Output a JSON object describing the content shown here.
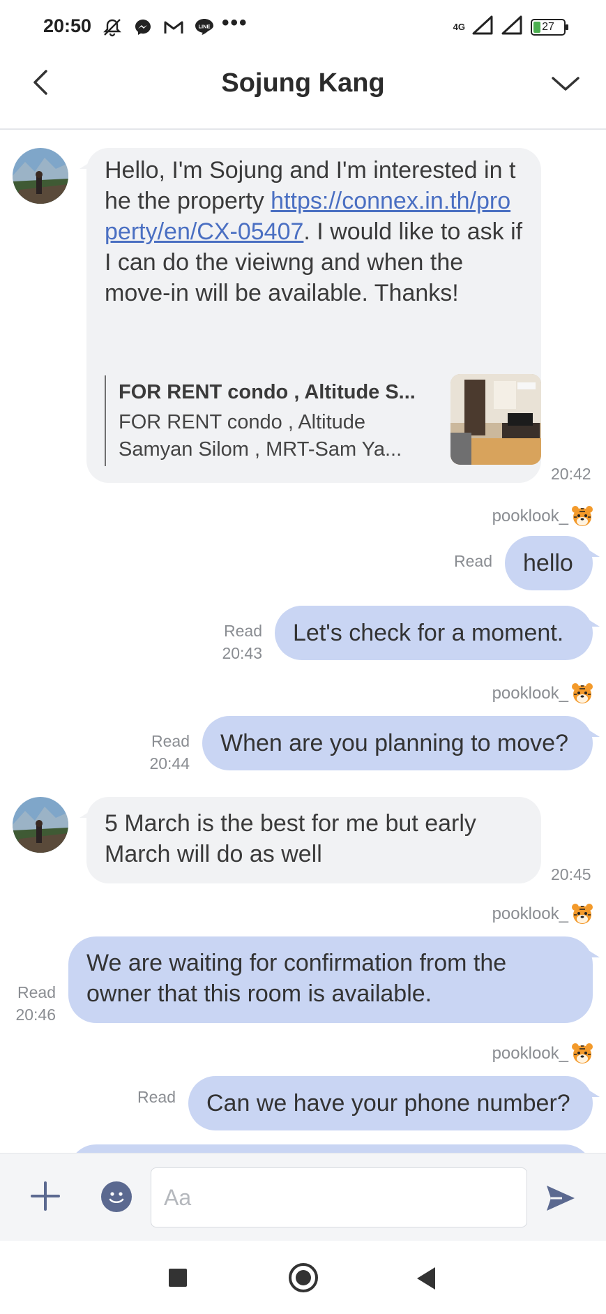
{
  "status_bar": {
    "time": "20:50",
    "icons": [
      "notifications-off-icon",
      "messenger-icon",
      "gmail-icon",
      "line-icon"
    ],
    "more": "•••",
    "network": "4G",
    "battery": "27"
  },
  "header": {
    "title": "Sojung Kang"
  },
  "messages": [
    {
      "direction": "in",
      "text_before_link": "Hello, I'm Sojung and I'm interested in the the property ",
      "link": "https://connex.in.th/property/en/CX-05407",
      "text_after_link": ". I would like to ask if I can do the vieiwng and when the move-in will be available. Thanks!",
      "preview_title": "FOR RENT condo , Altitude S...",
      "preview_desc": "FOR RENT condo , Altitude Samyan Silom , MRT-Sam Ya...",
      "time": "20:42"
    },
    {
      "direction": "out",
      "sender": "pooklook_",
      "text": "hello",
      "read": "Read",
      "time": ""
    },
    {
      "direction": "out",
      "sender": "",
      "text": "Let's check for a moment.",
      "read": "Read",
      "time": "20:43"
    },
    {
      "direction": "out",
      "sender": "pooklook_",
      "text": "When are you planning to move?",
      "read": "Read",
      "time": "20:44"
    },
    {
      "direction": "in",
      "text": "5 March is the best for me but early March will do as well",
      "time": "20:45"
    },
    {
      "direction": "out",
      "sender": "pooklook_",
      "text": "We are waiting for confirmation from the owner that this room is available.",
      "read": "Read",
      "time": "20:46"
    },
    {
      "direction": "out",
      "sender": "pooklook_",
      "text": "Can we have your phone number?",
      "read": "Read",
      "time": ""
    }
  ],
  "composer": {
    "placeholder": "Aa"
  },
  "colors": {
    "incoming_bubble": "#f1f2f4",
    "outgoing_bubble": "#c9d5f3",
    "link": "#4a6fc2"
  }
}
